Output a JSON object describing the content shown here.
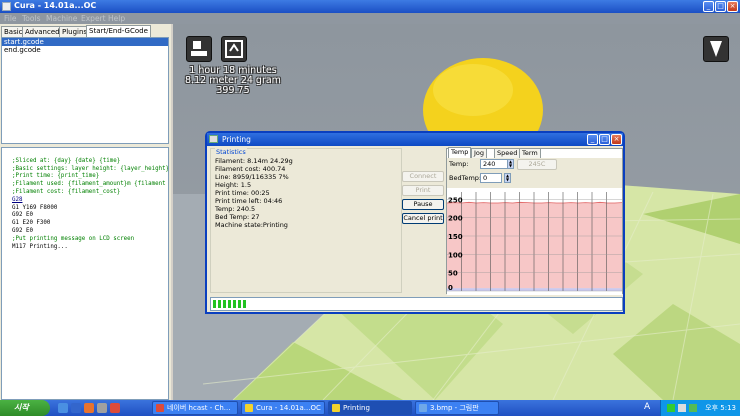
{
  "window": {
    "title": "Cura - 14.01a...OC"
  },
  "menu": [
    "File",
    "Tools",
    "Machine",
    "Expert",
    "Help"
  ],
  "left_tabs": [
    "Basic",
    "Advanced",
    "Plugins",
    "Start/End-GCode"
  ],
  "gcode_files": [
    "start.gcode",
    "end.gcode"
  ],
  "gcode_lines": [
    ";Sliced at: {day} {date} {time}",
    ";Basic settings: layer height: {layer_height}",
    ";Print time: {print_time}",
    ";Filament used: {filament_amount}m {filament",
    ";Filament cost: {filament_cost}",
    "G28",
    "G1 Y169 F8000",
    "G92 E0",
    "G1 E20 F300",
    "G92 E0",
    ";Put printing message on LCD screen",
    "M117 Printing..."
  ],
  "view_stats": [
    "1 hour 18 minutes",
    "8.12 meter 24 gram",
    "399.75"
  ],
  "dialog": {
    "title": "Printing",
    "stats_legend": "Statistics",
    "stats": [
      "Filament: 8.14m 24.29g",
      "Filament cost: 400.74",
      "Line: 8959/116335 7%",
      "Height: 1.5",
      "Print time: 00:25",
      "Print time left: 04:46",
      "Temp: 240.5",
      "Bed Temp: 27",
      "Machine state:Printing"
    ],
    "buttons": {
      "connect": "Connect",
      "print": "Print",
      "pause": "Pause",
      "cancel": "Cancel print"
    },
    "tabs": [
      "Temp",
      "Jog",
      "Speed",
      "Term"
    ],
    "temp_label": "Temp:",
    "temp_value": "240",
    "temp_apply": "245C",
    "bedtemp_label": "BedTemp:",
    "bedtemp_value": "0",
    "progress": 0.08
  },
  "chart_data": {
    "type": "line",
    "yticks": [
      0,
      50,
      100,
      150,
      200,
      250
    ],
    "ylim": [
      0,
      270
    ],
    "series": [
      {
        "values": [
          240,
          241,
          240,
          242,
          240,
          241,
          240,
          240,
          241,
          240,
          242,
          241,
          240,
          240,
          241,
          240,
          240,
          241,
          240,
          241,
          240,
          242,
          240,
          240,
          241
        ]
      }
    ],
    "grid": true
  },
  "taskbar": {
    "start": "시작",
    "tasks": [
      "네이버 hcast - Ch...",
      "Cura - 14.01a...OC",
      "Printing",
      "3.bmp - 그림판"
    ],
    "clock": "오후 5:13",
    "tray_lang": "A"
  },
  "colors": {
    "accent": "#0a3fbf",
    "graph_fill": "#f7c7c7",
    "graph_line": "#e06060",
    "progress": "#22c322"
  }
}
